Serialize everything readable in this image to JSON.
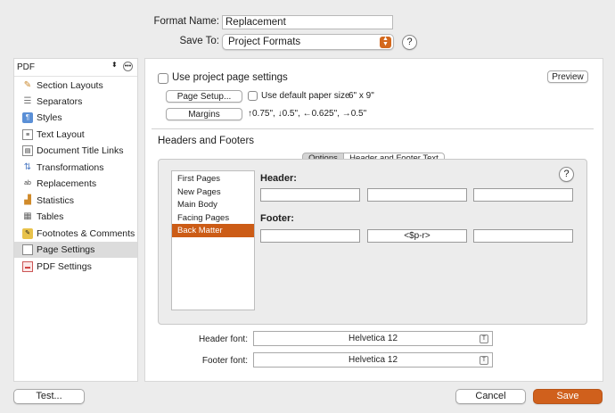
{
  "format": {
    "name_label": "Format Name:",
    "name_value": "Replacement",
    "save_to_label": "Save To:",
    "save_to_value": "Project Formats",
    "help": "?"
  },
  "sidebar": {
    "selector": "PDF",
    "items": [
      {
        "label": "Section Layouts",
        "icon": "brush-icon"
      },
      {
        "label": "Separators",
        "icon": "separator-icon"
      },
      {
        "label": "Styles",
        "icon": "styles-icon"
      },
      {
        "label": "Text Layout",
        "icon": "text-layout-icon"
      },
      {
        "label": "Document Title Links",
        "icon": "document-links-icon"
      },
      {
        "label": "Transformations",
        "icon": "transform-icon"
      },
      {
        "label": "Replacements",
        "icon": "replacements-icon"
      },
      {
        "label": "Statistics",
        "icon": "statistics-icon"
      },
      {
        "label": "Tables",
        "icon": "tables-icon"
      },
      {
        "label": "Footnotes & Comments",
        "icon": "footnotes-icon"
      },
      {
        "label": "Page Settings",
        "icon": "page-settings-icon"
      },
      {
        "label": "PDF Settings",
        "icon": "pdf-settings-icon"
      }
    ],
    "selected_index": 10
  },
  "page_settings": {
    "use_project_label": "Use project page settings",
    "preview_label": "Preview",
    "page_setup_label": "Page Setup...",
    "use_default_paper_label": "Use default paper size",
    "paper_size": "6\" x 9\"",
    "margins_label": "Margins",
    "margins_value": "↑0.75\", ↓0.5\", ←0.625\", →0.5\""
  },
  "headers_footers": {
    "section_title": "Headers and Footers",
    "tabs": [
      "Options",
      "Header and Footer Text"
    ],
    "active_tab": 0,
    "pages": [
      "First Pages",
      "New Pages",
      "Main Body",
      "Facing Pages",
      "Back Matter"
    ],
    "selected_page": 4,
    "header_label": "Header:",
    "footer_label": "Footer:",
    "header_fields": [
      "",
      "",
      ""
    ],
    "footer_fields": [
      "",
      "<$p-r>",
      ""
    ],
    "help": "?"
  },
  "fonts": {
    "header_label": "Header font:",
    "header_value": "Helvetica 12",
    "footer_label": "Footer font:",
    "footer_value": "Helvetica 12"
  },
  "buttons": {
    "test": "Test...",
    "cancel": "Cancel",
    "save": "Save"
  },
  "colors": {
    "accent": "#d0601c",
    "selection": "#cc5c16"
  }
}
